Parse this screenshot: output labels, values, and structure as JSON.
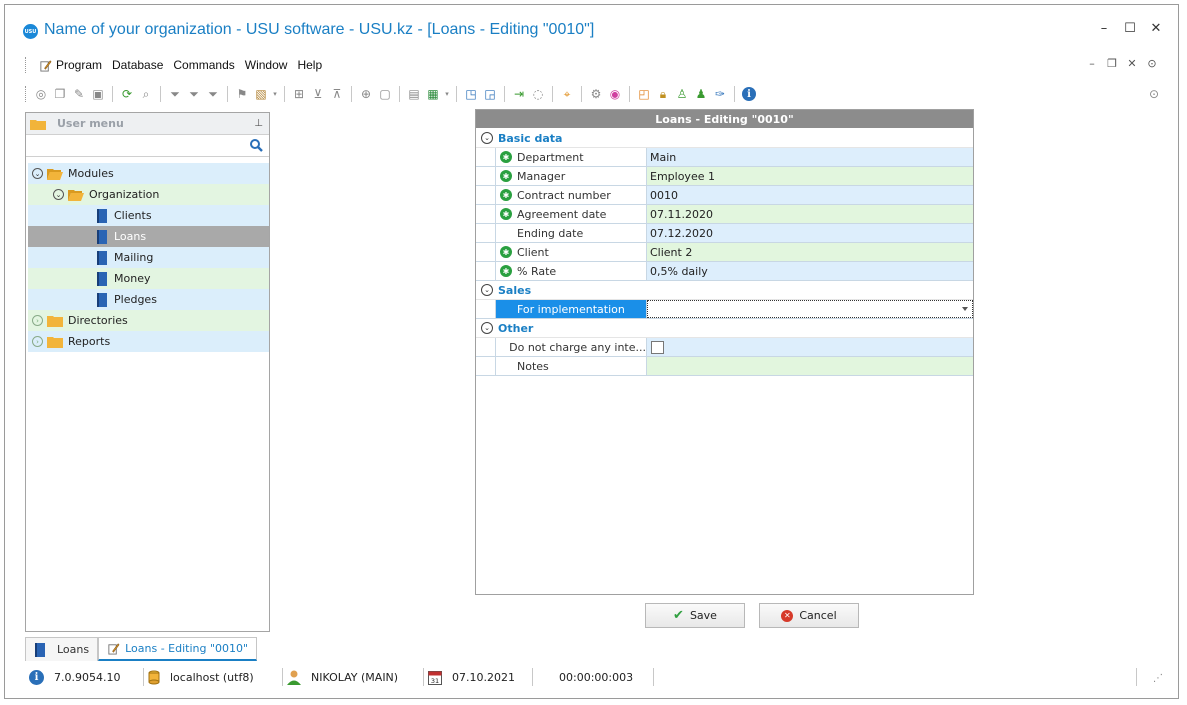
{
  "window": {
    "logo_text": "USU",
    "title": "Name of your organization - USU software - USU.kz - [Loans - Editing \"0010\"]"
  },
  "menu": {
    "items": [
      "Program",
      "Database",
      "Commands",
      "Window",
      "Help"
    ]
  },
  "user_menu": {
    "title": "User menu",
    "tree": [
      {
        "label": "Modules",
        "level": 0,
        "type": "folder",
        "expanded": true
      },
      {
        "label": "Organization",
        "level": 1,
        "type": "folder",
        "expanded": true
      },
      {
        "label": "Clients",
        "level": 2,
        "type": "item"
      },
      {
        "label": "Loans",
        "level": 2,
        "type": "item",
        "selected": true
      },
      {
        "label": "Mailing",
        "level": 2,
        "type": "item"
      },
      {
        "label": "Money",
        "level": 2,
        "type": "item"
      },
      {
        "label": "Pledges",
        "level": 2,
        "type": "item"
      },
      {
        "label": "Directories",
        "level": 0,
        "type": "folder",
        "expanded": false
      },
      {
        "label": "Reports",
        "level": 0,
        "type": "folder",
        "expanded": false
      }
    ]
  },
  "tabs": [
    {
      "label": "Loans",
      "active": false
    },
    {
      "label": "Loans - Editing \"0010\"",
      "active": true
    }
  ],
  "status": {
    "version": "7.0.9054.10",
    "server": "localhost (utf8)",
    "user": "NIKOLAY (MAIN)",
    "date": "07.10.2021",
    "timer": "00:00:00:003",
    "calendar_day": "31"
  },
  "editor": {
    "title": "Loans - Editing \"0010\"",
    "categories": {
      "basic": "Basic data",
      "sales": "Sales",
      "other": "Other"
    },
    "basic": [
      {
        "name": "Department",
        "value": "Main",
        "required": true
      },
      {
        "name": "Manager",
        "value": "Employee 1",
        "required": true
      },
      {
        "name": "Contract number",
        "value": "0010",
        "required": true
      },
      {
        "name": "Agreement date",
        "value": "07.11.2020",
        "required": true
      },
      {
        "name": "Ending date",
        "value": "07.12.2020",
        "required": false
      },
      {
        "name": "Client",
        "value": "Client 2",
        "required": true
      },
      {
        "name": "% Rate",
        "value": "0,5% daily",
        "required": true
      }
    ],
    "sales": [
      {
        "name": "For implementation",
        "value": ""
      }
    ],
    "other": [
      {
        "name": "Do not charge any inte...",
        "checked": false
      },
      {
        "name": "Notes",
        "value": ""
      }
    ],
    "save_label": "Save",
    "cancel_label": "Cancel"
  },
  "colors": {
    "accent": "#1a7fc4",
    "row_blue": "#ddeefc",
    "row_green": "#e2f6de",
    "selected": "#1a8fe8"
  }
}
